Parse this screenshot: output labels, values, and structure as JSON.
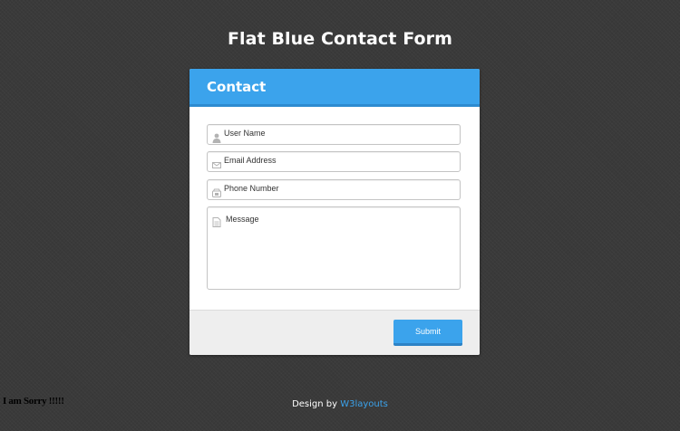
{
  "page": {
    "title": "Flat Blue Contact Form"
  },
  "form": {
    "header_title": "Contact",
    "fields": {
      "username": {
        "placeholder": "User Name",
        "icon": "user-icon"
      },
      "email": {
        "placeholder": "Email Address",
        "icon": "envelope-icon"
      },
      "phone": {
        "placeholder": "Phone Number",
        "icon": "phone-icon"
      },
      "message": {
        "placeholder": "Message",
        "icon": "document-icon"
      }
    },
    "submit_label": "Submit"
  },
  "footer": {
    "credit_prefix": "Design by ",
    "credit_link": "W3layouts"
  },
  "overlay": {
    "sorry_text": "I am Sorry !!!!!"
  },
  "colors": {
    "accent": "#3ba3ec",
    "accent_dark": "#2d8bd0",
    "background": "#3a3a3a",
    "footer_bar": "#eeeeee"
  }
}
